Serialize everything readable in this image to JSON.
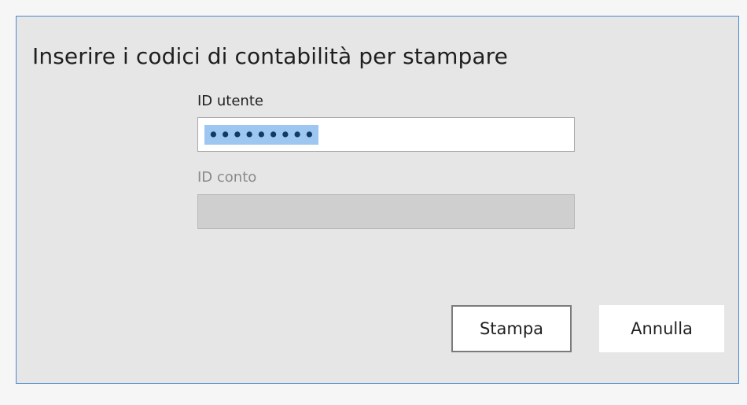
{
  "dialog": {
    "title": "Inserire i codici di contabilità per stampare",
    "fields": {
      "user_id": {
        "label": "ID utente",
        "value": "•••••••••",
        "state": "selected"
      },
      "account_id": {
        "label": "ID conto",
        "value": "",
        "state": "disabled"
      }
    },
    "buttons": {
      "print": "Stampa",
      "cancel": "Annulla"
    }
  },
  "colors": {
    "dialog_background": "#e6e6e6",
    "dialog_border": "#4a8bc9",
    "selection_highlight": "#9dc7f1",
    "disabled_field": "#cfcfcf"
  }
}
